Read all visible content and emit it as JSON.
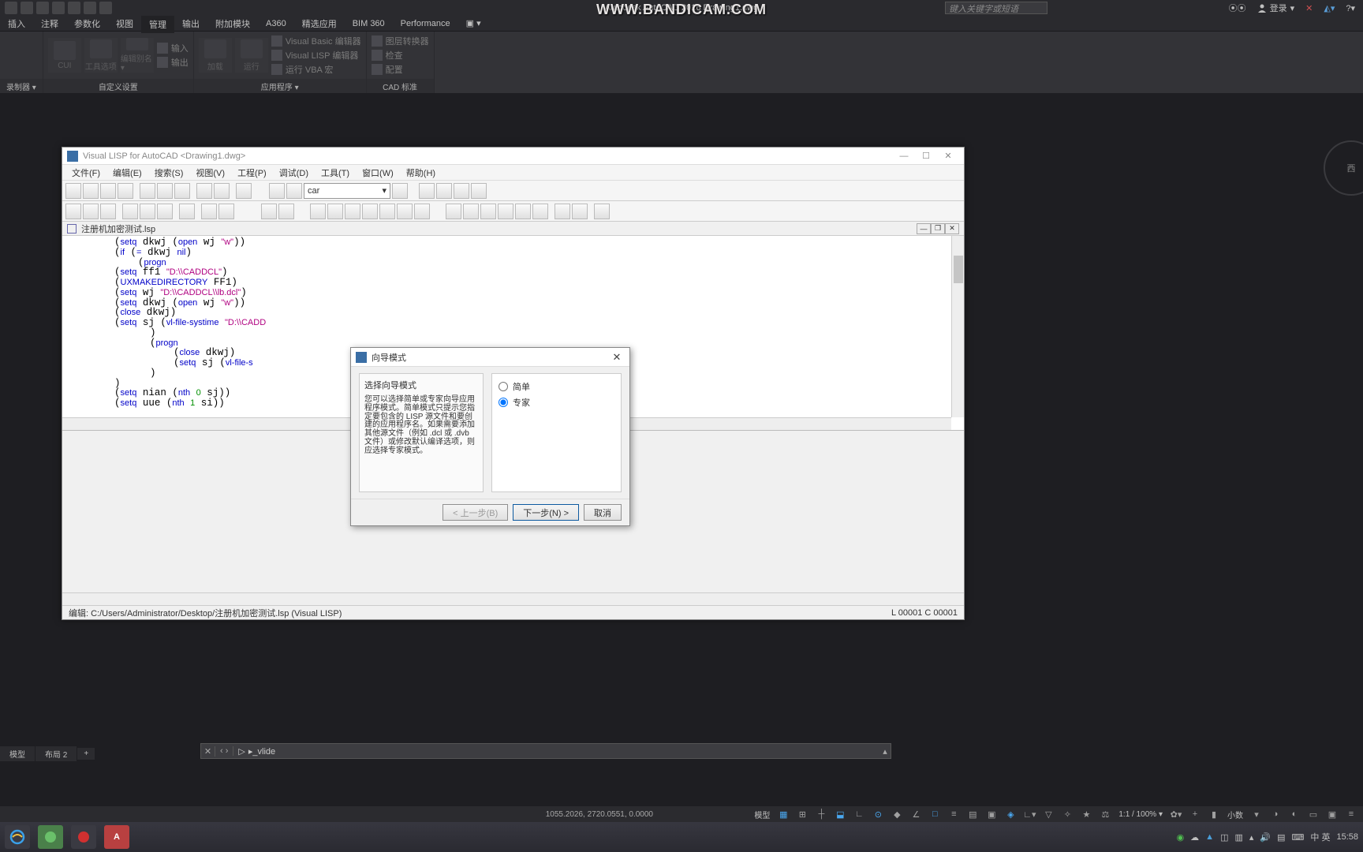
{
  "app": {
    "title": "Autodesk AutoCAD 2016   Drawing1.dwg",
    "watermark": "WWW.BANDICAM.COM",
    "search_placeholder": "键入关键字或短语",
    "login": "登录"
  },
  "menu": {
    "items": [
      "插入",
      "注释",
      "参数化",
      "视图",
      "管理",
      "输出",
      "附加模块",
      "A360",
      "精选应用",
      "BIM 360",
      "Performance"
    ],
    "active_index": 4
  },
  "ribbon": {
    "panels": [
      {
        "label": "录制器 ▾",
        "items": []
      },
      {
        "label": "自定义设置",
        "items": [
          {
            "txt": "CUI"
          },
          {
            "txt": "工具选项"
          },
          {
            "txt": "编辑别名▾"
          }
        ],
        "list": [
          {
            "txt": "输入"
          },
          {
            "txt": "输出"
          }
        ]
      },
      {
        "label": "应用程序 ▾",
        "items": [
          {
            "txt": "加载"
          },
          {
            "txt": "运行"
          }
        ],
        "list": [
          {
            "txt": "Visual Basic 编辑器"
          },
          {
            "txt": "Visual LISP 编辑器"
          },
          {
            "txt": "运行 VBA 宏"
          }
        ]
      },
      {
        "label": "CAD 标准",
        "items": [],
        "list": [
          {
            "txt": "图层转换器"
          },
          {
            "txt": "检查"
          },
          {
            "txt": "配置"
          }
        ]
      }
    ]
  },
  "navcube": {
    "face": "西"
  },
  "vlisp": {
    "title": "Visual LISP for AutoCAD <Drawing1.dwg>",
    "menu": [
      "文件(F)",
      "编辑(E)",
      "搜索(S)",
      "视图(V)",
      "工程(P)",
      "调试(D)",
      "工具(T)",
      "窗口(W)",
      "帮助(H)"
    ],
    "combo": "car",
    "doc_tab": "注册机加密测试.lsp",
    "code_lines": [
      [
        "        ",
        "(",
        "setq",
        " dkwj ",
        "(",
        "open",
        " wj ",
        "\"w\"",
        "))"
      ],
      [
        "        ",
        "(",
        "if",
        " ",
        "(",
        "=",
        " dkwj ",
        "nil",
        ")"
      ],
      [
        "            ",
        "(",
        "progn"
      ],
      [
        "        ",
        "(",
        "setq",
        " ff1 ",
        "\"D:\\\\CADDCL\"",
        ")"
      ],
      [
        "        ",
        "(",
        "UXMAKEDIRECTORY",
        " FF1",
        ")"
      ],
      [
        "        ",
        "(",
        "setq",
        " wj ",
        "\"D:\\\\CADDCL\\\\lb.dcl\"",
        ")"
      ],
      [
        "        ",
        "(",
        "setq",
        " dkwj ",
        "(",
        "open",
        " wj ",
        "\"w\"",
        "))"
      ],
      [
        "        ",
        "(",
        "close",
        " dkwj",
        ")"
      ],
      [
        "        ",
        "(",
        "setq",
        " sj ",
        "(",
        "vl-file-systime",
        " ",
        "\"D:\\\\CADD"
      ],
      [
        "              ",
        ")"
      ],
      [
        "              ",
        "(",
        "progn"
      ],
      [
        "                  ",
        "(",
        "close",
        " dkwj",
        ")"
      ],
      [
        "                  ",
        "(",
        "setq",
        " sj ",
        "(",
        "vl-file-s"
      ],
      [
        "              ",
        ")"
      ],
      [
        "        ",
        ")"
      ],
      [
        "        ",
        "(",
        "setq",
        " nian ",
        "(",
        "nth",
        " ",
        "0",
        " sj",
        "))"
      ],
      [
        "        ",
        "(",
        "setq",
        " uue ",
        "(",
        "nth",
        " ",
        "1",
        " si",
        "))"
      ]
    ],
    "status_left": "编辑: C:/Users/Administrator/Desktop/注册机加密测试.lsp  (Visual LISP)",
    "status_right": "L 00001  C 00001"
  },
  "wizard": {
    "title": "向导模式",
    "heading": "选择向导模式",
    "desc": "您可以选择简单或专家向导应用程序模式。简单模式只提示您指定要包含的 LISP 源文件和要创建的应用程序名。如果需要添加其他源文件（例如 .dcl 或 .dvb 文件）或修改默认编译选项，则应选择专家模式。",
    "opt_simple": "简单",
    "opt_expert": "专家",
    "btn_prev": "< 上一步(B)",
    "btn_next": "下一步(N) >",
    "btn_cancel": "取消"
  },
  "cmdline": {
    "text": "▸_vlide"
  },
  "modeltabs": {
    "items": [
      "模型",
      "布局 2"
    ],
    "plus": "+"
  },
  "statusbar": {
    "coords": "1055.2026, 2720.0551, 0.0000",
    "model": "模型",
    "scale": "1:1 / 100% ▾",
    "units": "小数"
  },
  "taskbar": {
    "tray": {
      "time": "15:58",
      "lang": "中 英"
    },
    "apps": [
      "ie",
      "start",
      "rec",
      "acad"
    ]
  }
}
